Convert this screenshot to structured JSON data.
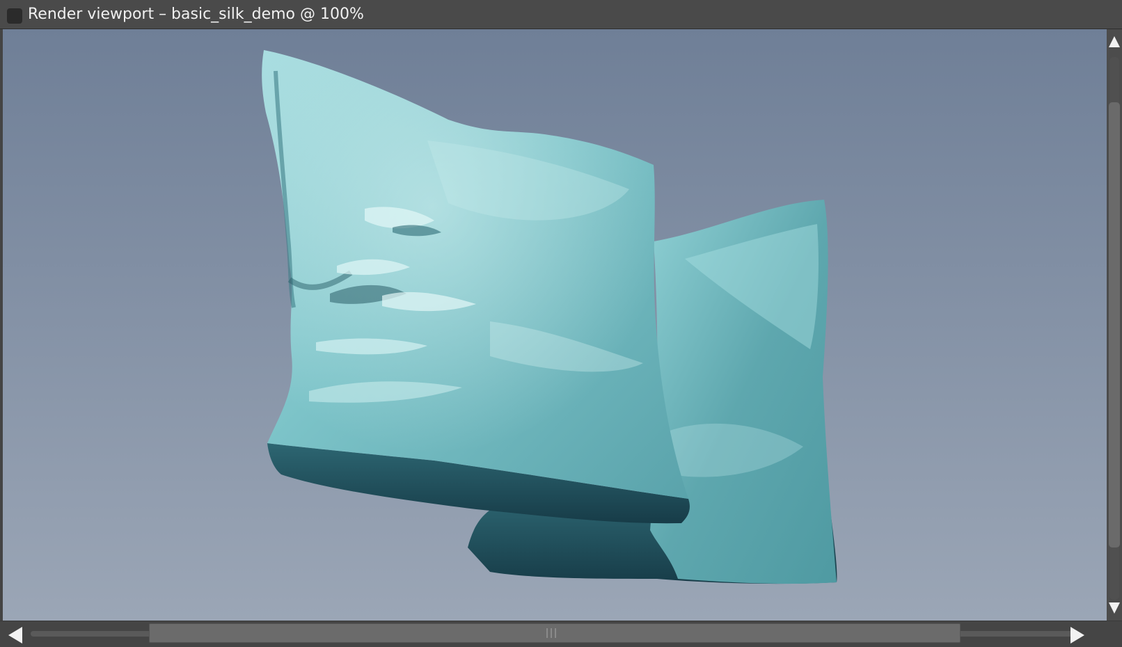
{
  "window": {
    "title": "Render viewport – basic_silk_demo @ 100%"
  },
  "viewport": {
    "scene": "two-silk-pillows-render",
    "colors": {
      "background_top": "#6f7f97",
      "background_bottom": "#9ba6b6",
      "silk_light": "#a8dde0",
      "silk_mid": "#6fb7bd",
      "silk_dark": "#1f4d5a"
    }
  },
  "scrollbars": {
    "vertical": {
      "up_icon": "triangle-up",
      "down_icon": "triangle-down"
    },
    "horizontal": {
      "left_icon": "triangle-left",
      "right_icon": "triangle-right"
    }
  }
}
